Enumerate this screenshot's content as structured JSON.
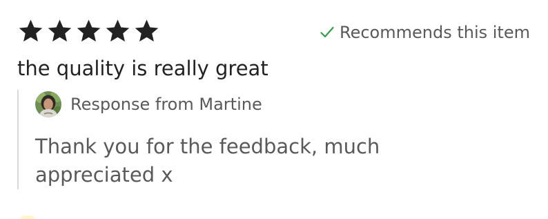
{
  "review": {
    "rating": {
      "value": 5,
      "max": 5,
      "star_icon": "star-icon",
      "star_color": "#222222"
    },
    "recommends": {
      "icon": "check-icon",
      "icon_color": "#2f9e44",
      "label": "Recommends this item"
    },
    "text": "the quality is really great",
    "response": {
      "avatar_icon": "avatar",
      "from_label": "Response from Martine",
      "text": "Thank you for the feedback, much appreciated x",
      "border_color": "#d8d8d8"
    }
  }
}
